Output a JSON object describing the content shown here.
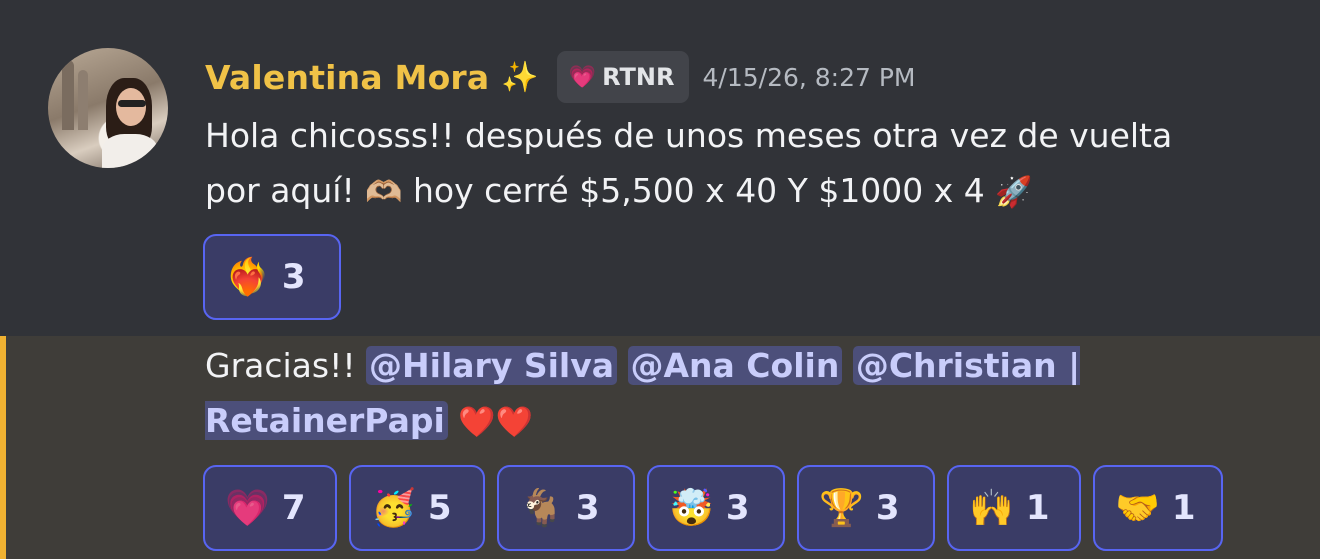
{
  "message1": {
    "username": "Valentina Mora",
    "name_emoji": "✨",
    "role_tag": {
      "icon": "heart-icon",
      "icon_glyph": "💗",
      "text": "RTNR"
    },
    "timestamp": "4/15/26, 8:27 PM",
    "text_line1": "Hola chicosss!! después de unos meses otra vez de vuelta",
    "text_line2_a": "por aquí! ",
    "emoji_heart_hands": "🫶🏼",
    "text_line2_b": " hoy cerré $5,500 x 40 Y $1000 x 4 ",
    "emoji_rocket": "🚀",
    "reactions": [
      {
        "emoji": "❤️‍🔥",
        "count": "3"
      }
    ]
  },
  "message2": {
    "text_prefix": "Gracias!! ",
    "mentions": [
      "@Hilary Silva",
      "@Ana Colin",
      "@Christian | RetainerPapi"
    ],
    "trailing_emoji": "❤️❤️",
    "reactions": [
      {
        "emoji": "💗",
        "count": "7"
      },
      {
        "emoji": "🥳",
        "count": "5"
      },
      {
        "emoji": "🐐",
        "count": "3"
      },
      {
        "emoji": "🤯",
        "count": "3"
      },
      {
        "emoji": "🏆",
        "count": "3"
      },
      {
        "emoji": "🙌",
        "count": "1"
      },
      {
        "emoji": "🤝",
        "count": "1"
      }
    ]
  },
  "colors": {
    "background": "#313338",
    "highlight_background": "#3f3d39",
    "mention_bar": "#f0b232",
    "username": "#f0c247",
    "reaction_border": "#5865f2",
    "mention_bg": "#4c4f7a"
  }
}
